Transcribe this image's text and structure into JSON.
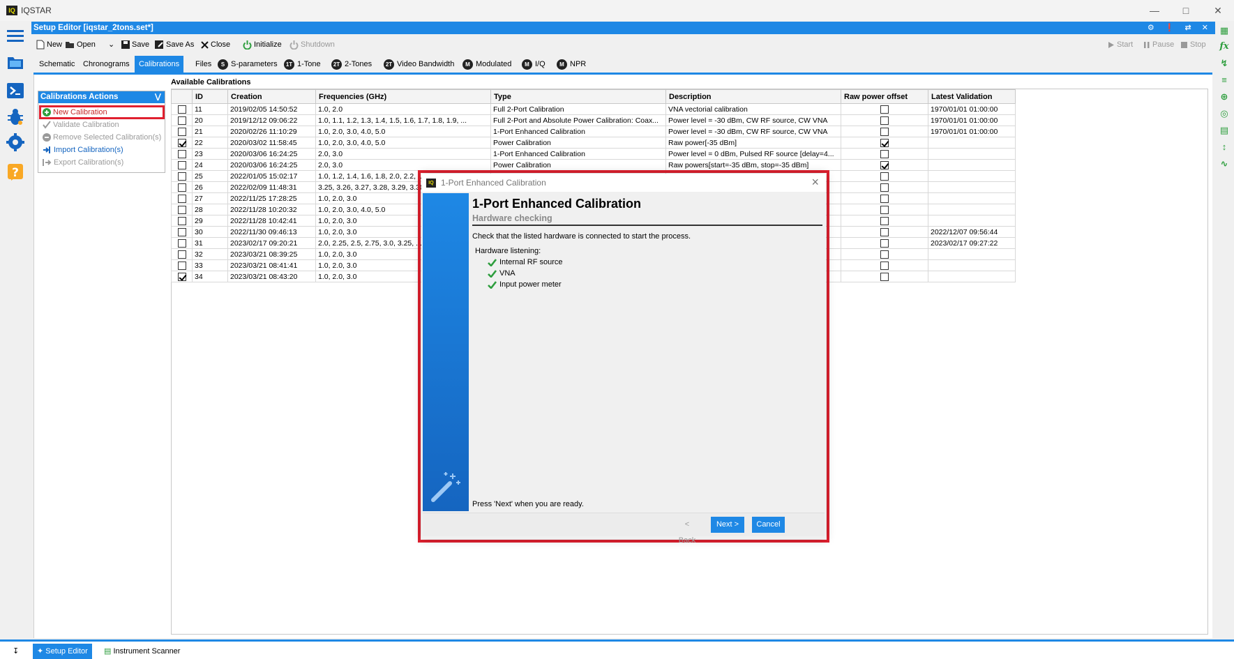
{
  "app": {
    "logo": "IQ",
    "title": "IQSTAR"
  },
  "editor": {
    "title": "Setup Editor [iqstar_2tons.set*]"
  },
  "toolbar": {
    "new": "New",
    "open": "Open",
    "save": "Save",
    "save_as": "Save As",
    "close": "Close",
    "initialize": "Initialize",
    "shutdown": "Shutdown",
    "start": "Start",
    "pause": "Pause",
    "stop": "Stop"
  },
  "tabs": [
    {
      "label": "Schematic"
    },
    {
      "label": "Chronograms"
    },
    {
      "label": "Calibrations"
    },
    {
      "label": "Files"
    },
    {
      "badge": "S",
      "label": "S-parameters"
    },
    {
      "badge": "1T",
      "label": "1-Tone"
    },
    {
      "badge": "2T",
      "label": "2-Tones"
    },
    {
      "badge": "2T",
      "label": "Video Bandwidth"
    },
    {
      "badge": "M",
      "label": "Modulated"
    },
    {
      "badge": "M",
      "label": "I/Q"
    },
    {
      "badge": "M",
      "label": "NPR"
    }
  ],
  "actions": {
    "header": "Calibrations Actions",
    "new_calibration": "New Calibration",
    "validate": "Validate Calibration",
    "remove": "Remove Selected Calibration(s)",
    "import": "Import Calibration(s)",
    "export": "Export Calibration(s)"
  },
  "available_label": "Available Calibrations",
  "table": {
    "headers": [
      "ID",
      "Creation",
      "Frequencies (GHz)",
      "Type",
      "Description",
      "Raw power offset",
      "Latest Validation"
    ],
    "rows": [
      {
        "checked": false,
        "id": "11",
        "creation": "2019/02/05 14:50:52",
        "freq": "1.0, 2.0",
        "type": "Full 2-Port Calibration",
        "desc": "VNA vectorial calibration",
        "raw": false,
        "latest": "1970/01/01 01:00:00"
      },
      {
        "checked": false,
        "id": "20",
        "creation": "2019/12/12 09:06:22",
        "freq": "1.0, 1.1, 1.2, 1.3, 1.4, 1.5, 1.6, 1.7, 1.8, 1.9, ...",
        "type": "Full 2-Port and Absolute Power Calibration: Coax...",
        "desc": "Power level = -30 dBm, CW RF source, CW VNA",
        "raw": false,
        "latest": "1970/01/01 01:00:00"
      },
      {
        "checked": false,
        "id": "21",
        "creation": "2020/02/26 11:10:29",
        "freq": "1.0, 2.0, 3.0, 4.0, 5.0",
        "type": "1-Port Enhanced Calibration",
        "desc": "Power level = -30 dBm, CW RF source, CW VNA",
        "raw": false,
        "latest": "1970/01/01 01:00:00"
      },
      {
        "checked": true,
        "id": "22",
        "creation": "2020/03/02 11:58:45",
        "freq": "1.0, 2.0, 3.0, 4.0, 5.0",
        "type": "Power Calibration",
        "desc": "Raw power[-35 dBm]",
        "raw": true,
        "latest": ""
      },
      {
        "checked": false,
        "id": "23",
        "creation": "2020/03/06 16:24:25",
        "freq": "2.0, 3.0",
        "type": "1-Port Enhanced Calibration",
        "desc": "Power level = 0 dBm, Pulsed RF source [delay=4...",
        "raw": false,
        "latest": ""
      },
      {
        "checked": false,
        "id": "24",
        "creation": "2020/03/06 16:24:25",
        "freq": "2.0, 3.0",
        "type": "Power Calibration",
        "desc": "Raw powers[start=-35 dBm, stop=-35 dBm]",
        "raw": true,
        "latest": ""
      },
      {
        "checked": false,
        "id": "25",
        "creation": "2022/01/05 15:02:17",
        "freq": "1.0, 1.2, 1.4, 1.6, 1.8, 2.0, 2.2, ...",
        "type": "",
        "desc": "",
        "raw": false,
        "latest": ""
      },
      {
        "checked": false,
        "id": "26",
        "creation": "2022/02/09 11:48:31",
        "freq": "3.25, 3.26, 3.27, 3.28, 3.29, 3.30, ...",
        "type": "",
        "desc": "",
        "raw": false,
        "latest": ""
      },
      {
        "checked": false,
        "id": "27",
        "creation": "2022/11/25 17:28:25",
        "freq": "1.0, 2.0, 3.0",
        "type": "",
        "desc": "",
        "raw": false,
        "latest": ""
      },
      {
        "checked": false,
        "id": "28",
        "creation": "2022/11/28 10:20:32",
        "freq": "1.0, 2.0, 3.0, 4.0, 5.0",
        "type": "",
        "desc": "",
        "raw": false,
        "latest": ""
      },
      {
        "checked": false,
        "id": "29",
        "creation": "2022/11/28 10:42:41",
        "freq": "1.0, 2.0, 3.0",
        "type": "",
        "desc": "",
        "raw": false,
        "latest": ""
      },
      {
        "checked": false,
        "id": "30",
        "creation": "2022/11/30 09:46:13",
        "freq": "1.0, 2.0, 3.0",
        "type": "",
        "desc": "",
        "raw": false,
        "latest": "2022/12/07 09:56:44"
      },
      {
        "checked": false,
        "id": "31",
        "creation": "2023/02/17 09:20:21",
        "freq": "2.0, 2.25, 2.5, 2.75, 3.0, 3.25, ...",
        "type": "",
        "desc": "",
        "raw": false,
        "latest": "2023/02/17 09:27:22"
      },
      {
        "checked": false,
        "id": "32",
        "creation": "2023/03/21 08:39:25",
        "freq": "1.0, 2.0, 3.0",
        "type": "",
        "desc": "",
        "raw": false,
        "latest": ""
      },
      {
        "checked": false,
        "id": "33",
        "creation": "2023/03/21 08:41:41",
        "freq": "1.0, 2.0, 3.0",
        "type": "",
        "desc": "",
        "raw": false,
        "latest": ""
      },
      {
        "checked": true,
        "id": "34",
        "creation": "2023/03/21 08:43:20",
        "freq": "1.0, 2.0, 3.0",
        "type": "",
        "desc": "",
        "raw": false,
        "latest": ""
      }
    ]
  },
  "dialog": {
    "logo": "IQ",
    "window_title": "1-Port Enhanced Calibration",
    "heading": "1-Port Enhanced Calibration",
    "subheading": "Hardware checking",
    "instruction": "Check that the listed hardware is connected to start the process.",
    "hardware_label": "Hardware listening:",
    "hardware": [
      "Internal RF source",
      "VNA",
      "Input power meter"
    ],
    "ready_text": "Press 'Next' when you are ready.",
    "back": "< Back",
    "next": "Next >",
    "cancel": "Cancel"
  },
  "statusbar": {
    "setup_editor": "Setup Editor",
    "instrument_scanner": "Instrument Scanner"
  },
  "colors": {
    "accent": "#1e88e5",
    "highlight_red": "#e0202f",
    "check_green": "#2e9e3e"
  }
}
